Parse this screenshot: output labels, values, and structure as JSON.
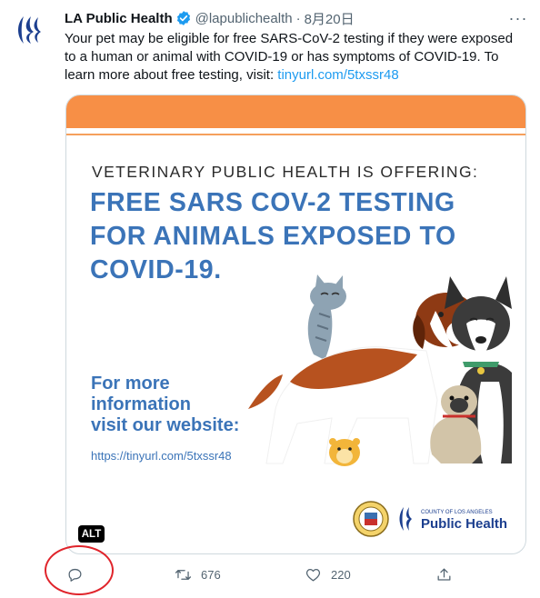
{
  "tweet": {
    "author_name": "LA Public Health",
    "handle": "@lapublichealth",
    "separator": "·",
    "date": "8月20日",
    "more_label": "···",
    "text_prefix": "Your pet may be eligible for free SARS-CoV-2 testing if they were exposed to a human or animal with COVID-19 or has symptoms of COVID-19. To learn more about free testing, visit: ",
    "link_text": "tinyurl.com/5txssr48"
  },
  "card": {
    "eyebrow": "VETERINARY PUBLIC HEALTH IS OFFERING:",
    "headline": "FREE SARS COV-2 TESTING FOR ANIMALS EXPOSED TO COVID-19.",
    "more_info_line1": "For more",
    "more_info_line2": "information",
    "more_info_line3": "visit our website:",
    "url": "https://tinyurl.com/5txssr48",
    "logo_small": "COUNTY OF LOS ANGELES",
    "logo_big": "Public Health",
    "colors": {
      "band": "#f78f46",
      "headline": "#3b74b8"
    }
  },
  "alt_badge": "ALT",
  "actions": {
    "reply_icon": "reply-icon",
    "retweet_count": "676",
    "like_count": "220",
    "share_icon": "share-icon"
  }
}
